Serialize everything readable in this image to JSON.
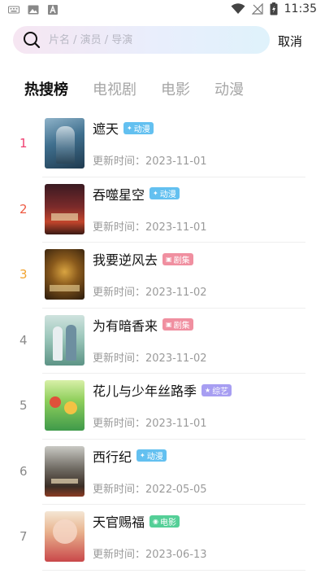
{
  "status_bar": {
    "time": "11:35"
  },
  "search": {
    "placeholder": "片名 / 演员 / 导演",
    "cancel_label": "取消"
  },
  "tabs": [
    {
      "label": "热搜榜",
      "active": true
    },
    {
      "label": "电视剧",
      "active": false
    },
    {
      "label": "电影",
      "active": false
    },
    {
      "label": "动漫",
      "active": false
    }
  ],
  "update_prefix": "更新时间：",
  "items": [
    {
      "rank": "1",
      "title": "遮天",
      "tag": "动漫",
      "tag_type": "anime",
      "updated": "2023-11-01"
    },
    {
      "rank": "2",
      "title": "吞噬星空",
      "tag": "动漫",
      "tag_type": "anime",
      "updated": "2023-11-01"
    },
    {
      "rank": "3",
      "title": "我要逆风去",
      "tag": "剧集",
      "tag_type": "drama",
      "updated": "2023-11-02"
    },
    {
      "rank": "4",
      "title": "为有暗香来",
      "tag": "剧集",
      "tag_type": "drama",
      "updated": "2023-11-02"
    },
    {
      "rank": "5",
      "title": "花儿与少年丝路季",
      "tag": "综艺",
      "tag_type": "variety",
      "updated": "2023-11-01"
    },
    {
      "rank": "6",
      "title": "西行纪",
      "tag": "动漫",
      "tag_type": "anime",
      "updated": "2022-05-05"
    },
    {
      "rank": "7",
      "title": "天官赐福",
      "tag": "电影",
      "tag_type": "movie",
      "updated": "2023-06-13"
    }
  ],
  "colors": {
    "rank_1": "#ef3e70",
    "rank_2": "#ee5a43",
    "rank_3": "#f2a430",
    "tag_anime": "#63c0f0",
    "tag_drama": "#f08fa0",
    "tag_variety": "#a79ef2",
    "tag_movie": "#54cf97"
  }
}
